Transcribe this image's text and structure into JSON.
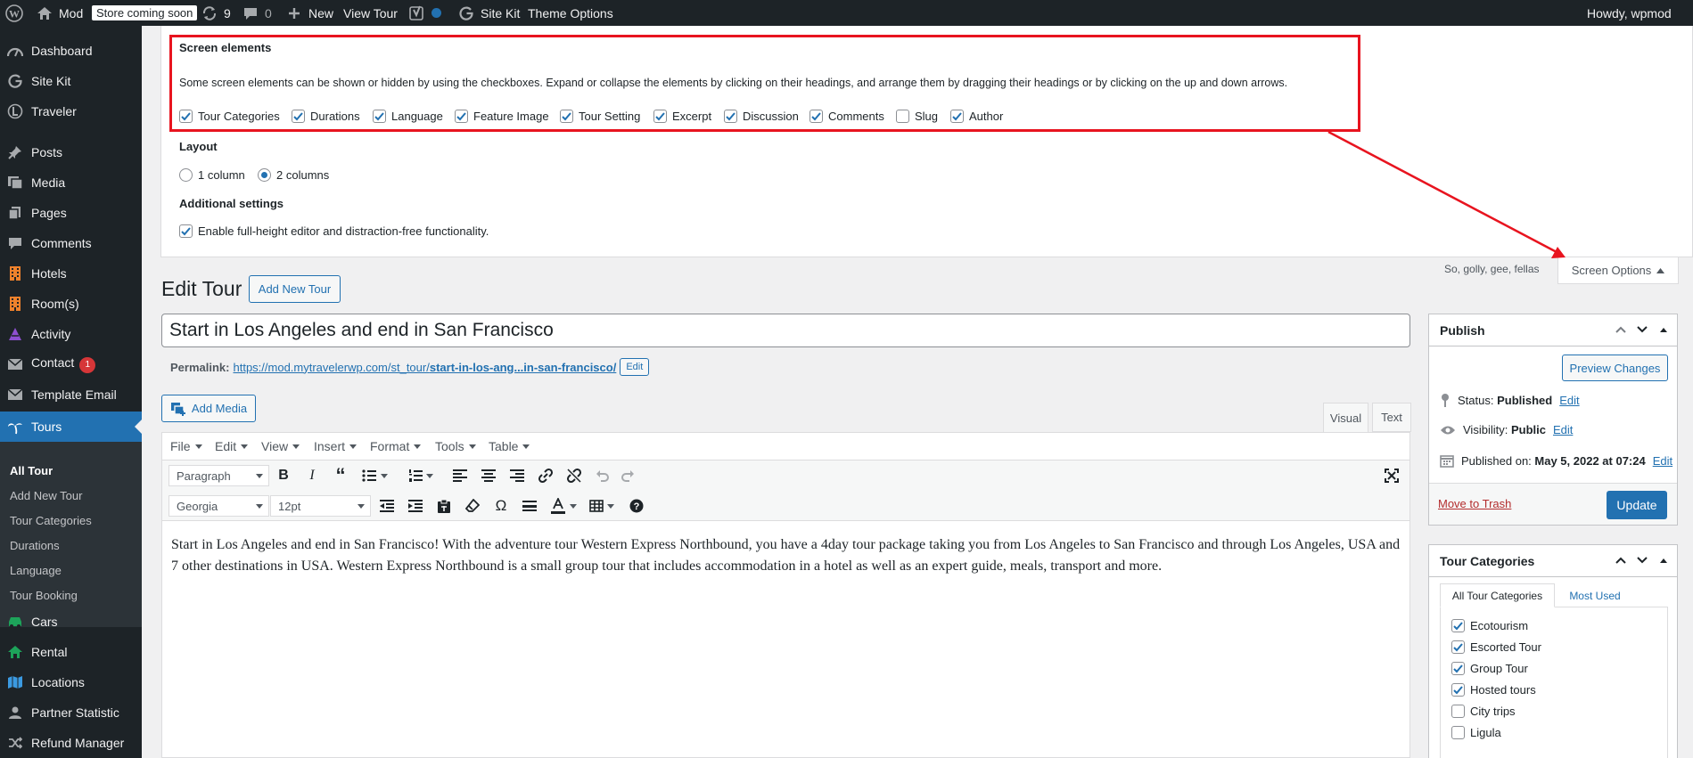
{
  "adminbar": {
    "site_name": "Mod",
    "store_badge": "Store coming soon",
    "updates_count": "9",
    "comments_count": "0",
    "new_label": "New",
    "view_tour_label": "View Tour",
    "sitekit_label": "Site Kit",
    "theme_options_label": "Theme Options",
    "howdy": "Howdy, wpmod"
  },
  "sidebar": {
    "items": [
      {
        "label": "Dashboard",
        "icon": "dashboard-icon"
      },
      {
        "label": "Site Kit",
        "icon": "sitekit-icon"
      },
      {
        "label": "Traveler",
        "icon": "traveler-icon"
      },
      {
        "label": "Posts",
        "icon": "pin-icon"
      },
      {
        "label": "Media",
        "icon": "media-icon"
      },
      {
        "label": "Pages",
        "icon": "pages-icon"
      },
      {
        "label": "Comments",
        "icon": "comment-icon"
      },
      {
        "label": "Hotels",
        "icon": "building-icon"
      },
      {
        "label": "Room(s)",
        "icon": "building-icon"
      },
      {
        "label": "Activity",
        "icon": "activity-icon"
      },
      {
        "label": "Contact",
        "icon": "mail-icon",
        "badge": "1"
      },
      {
        "label": "Template Email",
        "icon": "mail-icon"
      },
      {
        "label": "Tours",
        "icon": "palm-icon"
      },
      {
        "label": "Cars",
        "icon": "car-icon"
      },
      {
        "label": "Rental",
        "icon": "home-icon"
      },
      {
        "label": "Locations",
        "icon": "map-icon"
      },
      {
        "label": "Partner Statistic",
        "icon": "user-icon"
      },
      {
        "label": "Refund Manager",
        "icon": "shuffle-icon"
      }
    ],
    "submenu": [
      "All Tour",
      "Add New Tour",
      "Tour Categories",
      "Durations",
      "Language",
      "Tour Booking"
    ]
  },
  "screen_options": {
    "title": "Screen elements",
    "description": "Some screen elements can be shown or hidden by using the checkboxes. Expand or collapse the elements by clicking on their headings, and arrange them by dragging their headings or by clicking on the up and down arrows.",
    "elements": [
      {
        "label": "Tour Categories",
        "checked": true
      },
      {
        "label": "Durations",
        "checked": true
      },
      {
        "label": "Language",
        "checked": true
      },
      {
        "label": "Feature Image",
        "checked": true
      },
      {
        "label": "Tour Setting",
        "checked": true
      },
      {
        "label": "Excerpt",
        "checked": true
      },
      {
        "label": "Discussion",
        "checked": true
      },
      {
        "label": "Comments",
        "checked": true
      },
      {
        "label": "Slug",
        "checked": false
      },
      {
        "label": "Author",
        "checked": true
      }
    ],
    "layout_title": "Layout",
    "layout_options": [
      "1 column",
      "2 columns"
    ],
    "layout_selected": "2 columns",
    "additional_title": "Additional settings",
    "fullheight_label": "Enable full-height editor and distraction-free functionality.",
    "tab_label": "Screen Options",
    "help_text": "So, golly, gee, fellas"
  },
  "page": {
    "heading": "Edit Tour",
    "add_new_label": "Add New Tour",
    "post_title": "Start in Los Angeles and end in San Francisco",
    "permalink_label": "Permalink:",
    "permalink_base": "https://mod.mytravelerwp.com/st_tour/",
    "permalink_slug": "start-in-los-ang...in-san-francisco/",
    "permalink_edit": "Edit",
    "add_media_label": "Add Media"
  },
  "editor": {
    "tabs": [
      "Visual",
      "Text"
    ],
    "active_tab": "Visual",
    "menus": [
      "File",
      "Edit",
      "View",
      "Insert",
      "Format",
      "Tools",
      "Table"
    ],
    "block_format": "Paragraph",
    "font_family": "Georgia",
    "font_size": "12pt",
    "content": "Start in Los Angeles and end in San Francisco! With the adventure tour Western Express Northbound, you have a 4day tour package taking you from Los Angeles to San Francisco and through Los Angeles, USA and 7 other destinations in USA. Western Express Northbound is a small group tour that includes accommodation in a hotel as well as an expert guide, meals, transport and more."
  },
  "publish": {
    "title": "Publish",
    "preview_label": "Preview Changes",
    "status_label": "Status:",
    "status_value": "Published",
    "visibility_label": "Visibility:",
    "visibility_value": "Public",
    "published_label": "Published on:",
    "published_value": "May 5, 2022 at 07:24",
    "edit_label": "Edit",
    "trash_label": "Move to Trash",
    "update_label": "Update"
  },
  "categories": {
    "title": "Tour Categories",
    "tab_all": "All Tour Categories",
    "tab_used": "Most Used",
    "items": [
      {
        "label": "Ecotourism",
        "checked": true
      },
      {
        "label": "Escorted Tour",
        "checked": true
      },
      {
        "label": "Group Tour",
        "checked": true
      },
      {
        "label": "Hosted tours",
        "checked": true
      },
      {
        "label": "City trips",
        "checked": false
      },
      {
        "label": "Ligula",
        "checked": false
      }
    ]
  },
  "colors": {
    "adminbar_bg": "#1d2327",
    "accent": "#2271b1",
    "highlight_box": "#e8141f",
    "trash": "#b32d2e"
  }
}
